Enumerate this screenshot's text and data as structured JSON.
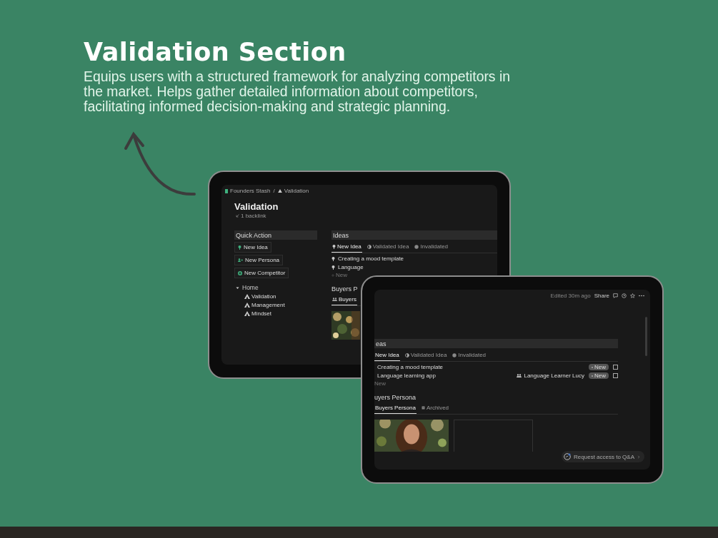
{
  "heading": "Validation Section",
  "description": "Equips users with a structured framework for analyzing competitors in the market. Helps gather detailed information about competitors, facilitating informed decision-making and strategic planning.",
  "tablet_back": {
    "breadcrumb": [
      "Founders Stash",
      "Validation"
    ],
    "separator": "/",
    "page_title": "Validation",
    "backlinks": "1 backlink",
    "quick_action": {
      "title": "Quick Action",
      "buttons": [
        {
          "label": "New Idea",
          "kind": "idea"
        },
        {
          "label": "New Persona",
          "kind": "persona"
        },
        {
          "label": "New Competitor",
          "kind": "competitor"
        }
      ]
    },
    "tree": {
      "label": "Home",
      "expanded": true,
      "children": [
        {
          "label": "Validation"
        },
        {
          "label": "Management"
        },
        {
          "label": "Mindset"
        }
      ]
    },
    "ideas": {
      "title": "Ideas",
      "tabs": [
        {
          "label": "New Idea",
          "selected": true
        },
        {
          "label": "Validated Idea",
          "selected": false
        },
        {
          "label": "Invalidated",
          "selected": false
        }
      ],
      "rows": [
        "Creating a mood template",
        "Language"
      ],
      "new_label": "New"
    },
    "personas": {
      "title": "Buyers P",
      "tabs": [
        {
          "label": "Buyers",
          "selected": true
        }
      ],
      "cards": [
        {
          "kind": "picture"
        }
      ]
    }
  },
  "tablet_front": {
    "edited": "Edited 30m ago",
    "share": "Share",
    "ideas": {
      "title": "eas",
      "tabs": [
        {
          "label": "New Idea",
          "selected": true
        },
        {
          "label": "Validated Idea",
          "selected": false
        },
        {
          "label": "Invalidated",
          "selected": false
        }
      ],
      "rows": [
        {
          "title": "Creating a mood template",
          "status": "New",
          "checked": false
        },
        {
          "title": "Language learning app",
          "persona": "Language Learner Lucy",
          "status": "New",
          "checked": false
        }
      ],
      "new_label": "New"
    },
    "personas": {
      "title": "uyers Persona",
      "tabs": [
        {
          "label": "Buyers Persona",
          "selected": true
        },
        {
          "label": "Archived",
          "selected": false
        }
      ],
      "cards": [
        {
          "kind": "picture"
        },
        {
          "kind": "empty"
        }
      ]
    },
    "qa_button": "Request access to Q&A"
  }
}
